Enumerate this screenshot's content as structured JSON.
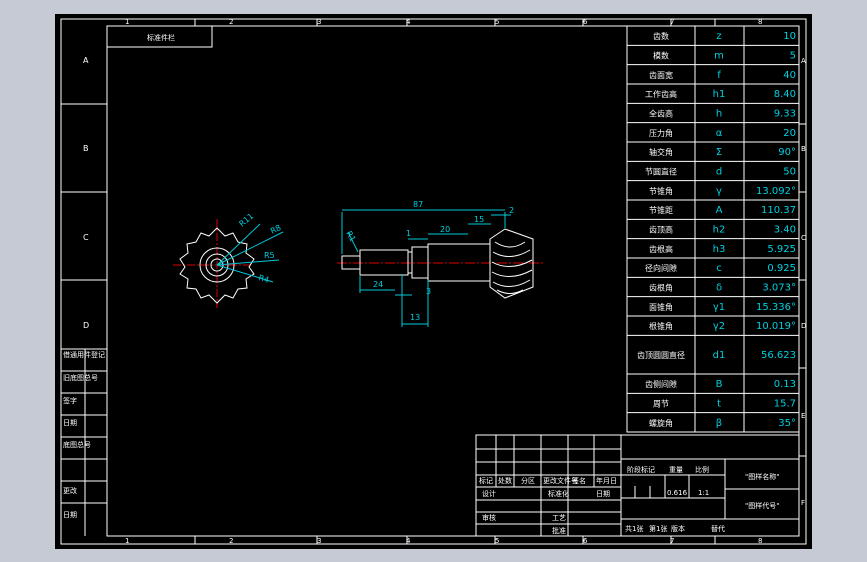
{
  "border": {
    "columns": [
      "1",
      "2",
      "3",
      "4",
      "5",
      "6",
      "7",
      "8"
    ],
    "rows": [
      "A",
      "B",
      "C",
      "D",
      "E",
      "F"
    ]
  },
  "top_left_box": "标准件栏",
  "left_strip": [
    "借通用件登记",
    "旧底图总号",
    "签字",
    "日期",
    "底图总号",
    "更改",
    "日期"
  ],
  "dimensions": {
    "d87": "87",
    "d2": "2",
    "d15": "15",
    "d20": "20",
    "d1": "1",
    "r1": "R1",
    "d24": "24",
    "d3": "3",
    "d13": "13"
  },
  "radii": {
    "r11": "R11",
    "r8": "R8",
    "r5": "R5",
    "r4": "R4"
  },
  "param_table": [
    {
      "name": "齿数",
      "sym": "z",
      "val": "10"
    },
    {
      "name": "模数",
      "sym": "m",
      "val": "5"
    },
    {
      "name": "齿面宽",
      "sym": "f",
      "val": "40"
    },
    {
      "name": "工作齿高",
      "sym": "h1",
      "val": "8.40"
    },
    {
      "name": "全齿高",
      "sym": "h",
      "val": "9.33"
    },
    {
      "name": "压力角",
      "sym": "α",
      "val": "20"
    },
    {
      "name": "轴交角",
      "sym": "Σ",
      "val": "90°"
    },
    {
      "name": "节圆直径",
      "sym": "d",
      "val": "50"
    },
    {
      "name": "节锥角",
      "sym": "γ",
      "val": "13.092°"
    },
    {
      "name": "节锥距",
      "sym": "A",
      "val": "110.37"
    },
    {
      "name": "齿顶高",
      "sym": "h2",
      "val": "3.40"
    },
    {
      "name": "齿根高",
      "sym": "h3",
      "val": "5.925"
    },
    {
      "name": "径向间隙",
      "sym": "c",
      "val": "0.925"
    },
    {
      "name": "齿根角",
      "sym": "δ",
      "val": "3.073°"
    },
    {
      "name": "面锥角",
      "sym": "γ1",
      "val": "15.336°"
    },
    {
      "name": "根锥角",
      "sym": "γ2",
      "val": "10.019°"
    },
    {
      "name": "齿顶圆圆直径",
      "sym": "d1",
      "val": "56.623"
    },
    {
      "name": "齿侧间隙",
      "sym": "B",
      "val": "0.13"
    },
    {
      "name": "周节",
      "sym": "t",
      "val": "15.7"
    },
    {
      "name": "螺旋角",
      "sym": "β",
      "val": "35°"
    }
  ],
  "title_block": {
    "hdr": [
      "标记",
      "处数",
      "分区",
      "更改文件号",
      "签名",
      "年月日"
    ],
    "rows": [
      "设计",
      "",
      "审核",
      "工艺",
      "批准"
    ],
    "std": "标准化",
    "date": "日期",
    "stage": "阶段标记",
    "weight": "重量",
    "scale": "比例",
    "weight_val": "0.616",
    "scale_val": "1:1",
    "name": "\"图样名称\"",
    "code": "\"图样代号\"",
    "total": "共1张",
    "sheet": "第1张",
    "version": "版本",
    "replace": "替代"
  }
}
